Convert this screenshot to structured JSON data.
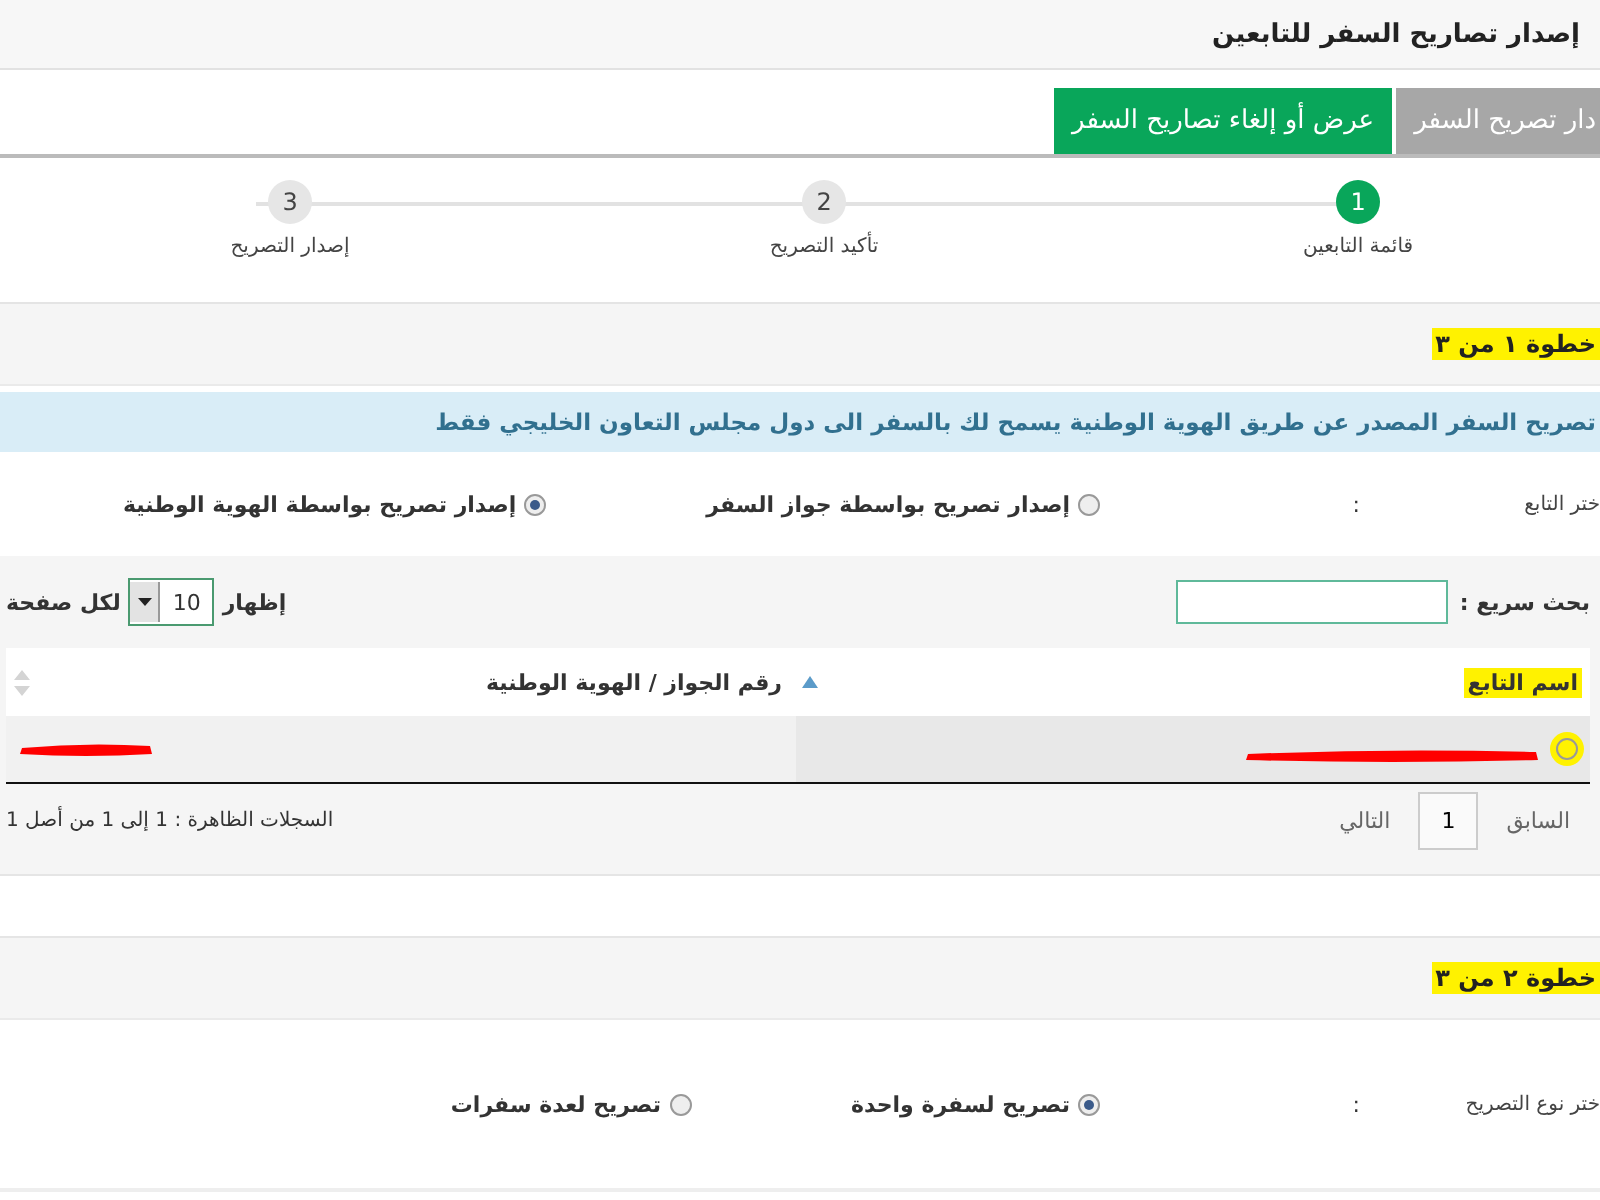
{
  "header": {
    "title": "إصدار تصاريح السفر للتابعين"
  },
  "tabs": [
    {
      "label": "دار تصريح السفر",
      "selected": true
    },
    {
      "label": "عرض أو إلغاء تصاريح السفر",
      "selected": false
    }
  ],
  "steps": [
    {
      "number": "1",
      "label": "قائمة التابعين",
      "selected": true
    },
    {
      "number": "2",
      "label": "تأكيد التصريح",
      "selected": false
    },
    {
      "number": "3",
      "label": "إصدار التصريح",
      "selected": false
    }
  ],
  "step1": {
    "heading": {
      "text": "خطوة ١ من ٣",
      "highlighted": true
    },
    "notice": "تصريح السفر المصدر عن طريق الهوية الوطنية يسمح لك بالسفر الى دول مجلس التعاون الخليجي فقط",
    "choice": {
      "label": "ختر التابع",
      "separator": ":",
      "options": [
        {
          "label": "إصدار تصريح بواسطة جواز السفر",
          "selected": false
        },
        {
          "label": "إصدار تصريح بواسطة الهوية الوطنية",
          "selected": true
        }
      ]
    },
    "search": {
      "label": "بحث سريع :"
    },
    "page_size": {
      "prefix": "إظهار",
      "value": "10",
      "suffix": "لكل صفحة"
    },
    "table": {
      "columns": [
        {
          "label": "اسم التابع",
          "highlighted": true,
          "sorted": true
        },
        {
          "label": "رقم الجواز / الهوية الوطنية",
          "highlighted": false,
          "sorted": false
        }
      ],
      "rows": [
        {
          "selected": false,
          "highlighted": true,
          "cells": [
            {
              "redacted": true
            },
            {
              "redacted": true
            }
          ]
        }
      ]
    },
    "pager": {
      "previous": "السابق",
      "page": "1",
      "next": "التالي"
    },
    "records": "السجلات الظاهرة : 1 إلى 1 من أصل 1"
  },
  "step2": {
    "heading": {
      "text": "خطوة ٢ من ٣",
      "highlighted": true
    },
    "choice": {
      "label": "ختر نوع التصريح",
      "separator": ":",
      "options": [
        {
          "label": "تصريح لسفرة واحدة",
          "selected": true
        },
        {
          "label": "تصريح لعدة سفرات",
          "selected": false
        }
      ]
    }
  }
}
